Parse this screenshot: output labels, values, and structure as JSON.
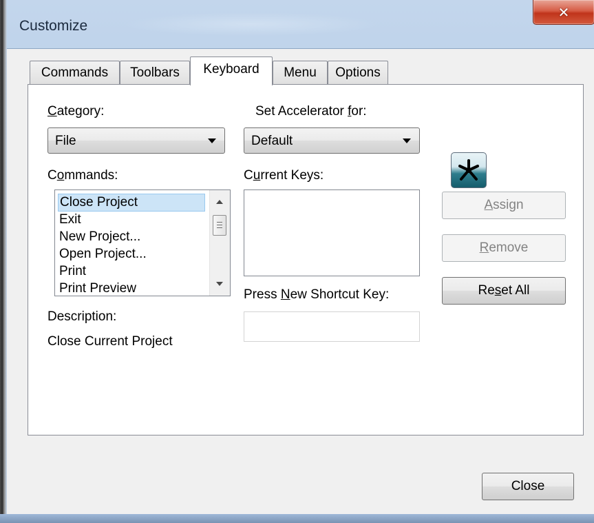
{
  "window": {
    "title": "Customize",
    "close_glyph": "✕"
  },
  "tabs": [
    {
      "label": "Commands",
      "active": false
    },
    {
      "label": "Toolbars",
      "active": false
    },
    {
      "label": "Keyboard",
      "active": true
    },
    {
      "label": "Menu",
      "active": false
    },
    {
      "label": "Options",
      "active": false
    }
  ],
  "keyboard": {
    "category": {
      "label_pre": "",
      "label_u": "C",
      "label_post": "ategory:",
      "value": "File"
    },
    "commands": {
      "label_pre": "C",
      "label_u": "o",
      "label_post": "mmands:",
      "items": [
        "Close Project",
        "Exit",
        "New Project...",
        "Open Project...",
        "Print",
        "Print Preview"
      ],
      "selected_index": 0
    },
    "description": {
      "label": "Description:",
      "value": "Close Current Project"
    },
    "set_accelerator": {
      "label_pre": "Set Accelerator ",
      "label_u": "f",
      "label_post": "or:",
      "value": "Default"
    },
    "current_keys": {
      "label_pre": "C",
      "label_u": "u",
      "label_post": "rrent Keys:"
    },
    "new_shortcut": {
      "label_pre": "Press ",
      "label_u": "N",
      "label_post": "ew Shortcut Key:",
      "value": ""
    },
    "accelerator_icon": "network-node-icon",
    "buttons": {
      "assign": {
        "pre": "",
        "u": "A",
        "post": "ssign",
        "enabled": false
      },
      "remove": {
        "pre": "",
        "u": "R",
        "post": "emove",
        "enabled": false
      },
      "reset_all": {
        "pre": "Re",
        "u": "s",
        "post": "et All",
        "enabled": true
      }
    }
  },
  "footer": {
    "close_label": "Close"
  },
  "colors": {
    "selection": "#cce4f7",
    "close_button_red": "#c0341b"
  }
}
